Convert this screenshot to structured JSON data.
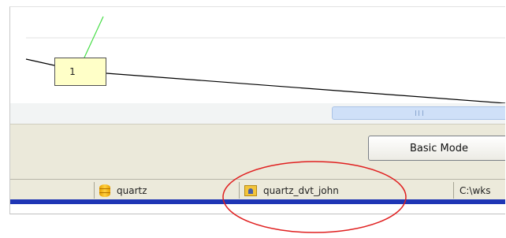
{
  "canvas": {
    "node_label": "1",
    "colors": {
      "node_fill": "#ffffc8",
      "connector": "#000000",
      "link": "#44dd44"
    }
  },
  "toolbar": {
    "mode_button_label": "Basic Mode"
  },
  "status_bar": {
    "database_label": "quartz",
    "workspace_label": "quartz_dvt_john",
    "path_label": "C:\\wks"
  },
  "colors": {
    "status_underline": "#1f36b5",
    "annotation_ellipse": "#e02020"
  }
}
